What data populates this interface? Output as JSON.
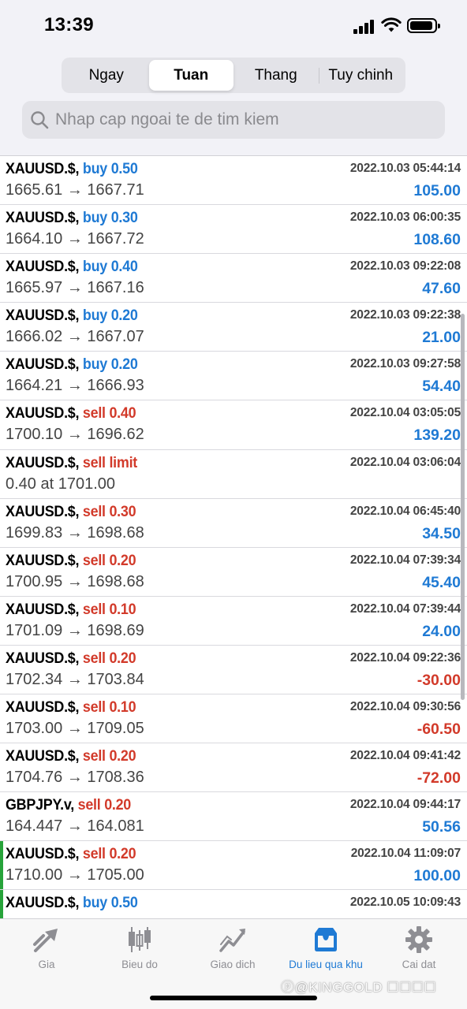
{
  "status_bar": {
    "time": "13:39"
  },
  "segments": {
    "items": [
      "Ngay",
      "Tuan",
      "Thang",
      "Tuy chinh"
    ],
    "selected": "Tuan"
  },
  "search": {
    "placeholder": "Nhap cap ngoai te de tim kiem"
  },
  "orders": [
    {
      "symbol": "XAUUSD.$,",
      "side": "buy",
      "lots": "0.50",
      "time": "2022.10.03 05:44:14",
      "prices": "1665.61 → 1667.71",
      "profit": "105.00",
      "marked": false
    },
    {
      "symbol": "XAUUSD.$,",
      "side": "buy",
      "lots": "0.30",
      "time": "2022.10.03 06:00:35",
      "prices": "1664.10 → 1667.72",
      "profit": "108.60",
      "marked": false
    },
    {
      "symbol": "XAUUSD.$,",
      "side": "buy",
      "lots": "0.40",
      "time": "2022.10.03 09:22:08",
      "prices": "1665.97 → 1667.16",
      "profit": "47.60",
      "marked": false
    },
    {
      "symbol": "XAUUSD.$,",
      "side": "buy",
      "lots": "0.20",
      "time": "2022.10.03 09:22:38",
      "prices": "1666.02 → 1667.07",
      "profit": "21.00",
      "marked": false
    },
    {
      "symbol": "XAUUSD.$,",
      "side": "buy",
      "lots": "0.20",
      "time": "2022.10.03 09:27:58",
      "prices": "1664.21 → 1666.93",
      "profit": "54.40",
      "marked": false
    },
    {
      "symbol": "XAUUSD.$,",
      "side": "sell",
      "lots": "0.40",
      "time": "2022.10.04 03:05:05",
      "prices": "1700.10 → 1696.62",
      "profit": "139.20",
      "marked": false
    },
    {
      "symbol": "XAUUSD.$,",
      "side": "sell",
      "lots": "limit",
      "time": "2022.10.04 03:06:04",
      "prices": "0.40 at 1701.00",
      "profit": "",
      "marked": false
    },
    {
      "symbol": "XAUUSD.$,",
      "side": "sell",
      "lots": "0.30",
      "time": "2022.10.04 06:45:40",
      "prices": "1699.83 → 1698.68",
      "profit": "34.50",
      "marked": false
    },
    {
      "symbol": "XAUUSD.$,",
      "side": "sell",
      "lots": "0.20",
      "time": "2022.10.04 07:39:34",
      "prices": "1700.95 → 1698.68",
      "profit": "45.40",
      "marked": false
    },
    {
      "symbol": "XAUUSD.$,",
      "side": "sell",
      "lots": "0.10",
      "time": "2022.10.04 07:39:44",
      "prices": "1701.09 → 1698.69",
      "profit": "24.00",
      "marked": false
    },
    {
      "symbol": "XAUUSD.$,",
      "side": "sell",
      "lots": "0.20",
      "time": "2022.10.04 09:22:36",
      "prices": "1702.34 → 1703.84",
      "profit": "-30.00",
      "marked": false
    },
    {
      "symbol": "XAUUSD.$,",
      "side": "sell",
      "lots": "0.10",
      "time": "2022.10.04 09:30:56",
      "prices": "1703.00 → 1709.05",
      "profit": "-60.50",
      "marked": false
    },
    {
      "symbol": "XAUUSD.$,",
      "side": "sell",
      "lots": "0.20",
      "time": "2022.10.04 09:41:42",
      "prices": "1704.76 → 1708.36",
      "profit": "-72.00",
      "marked": false
    },
    {
      "symbol": "GBPJPY.v,",
      "side": "sell",
      "lots": "0.20",
      "time": "2022.10.04 09:44:17",
      "prices": "164.447 → 164.081",
      "profit": "50.56",
      "marked": false
    },
    {
      "symbol": "XAUUSD.$,",
      "side": "sell",
      "lots": "0.20",
      "time": "2022.10.04 11:09:07",
      "prices": "1710.00 → 1705.00",
      "profit": "100.00",
      "marked": true
    },
    {
      "symbol": "XAUUSD.$,",
      "side": "buy",
      "lots": "0.50",
      "time": "2022.10.05 10:09:43",
      "prices": "",
      "profit": "",
      "marked": true
    }
  ],
  "tabbar": {
    "items": [
      {
        "label": "Gia",
        "icon": "quotes-arrows-icon",
        "active": false
      },
      {
        "label": "Bieu do",
        "icon": "candlestick-chart-icon",
        "active": false
      },
      {
        "label": "Giao dich",
        "icon": "trade-chart-icon",
        "active": false
      },
      {
        "label": "Du lieu qua khu",
        "icon": "history-inbox-icon",
        "active": true
      },
      {
        "label": "Cai dat",
        "icon": "gear-icon",
        "active": false
      }
    ]
  },
  "watermark": "ⓟ@KINGGOLD ☐☐☐☐",
  "colors": {
    "buy": "#1f7ad4",
    "sell": "#d23a2a",
    "active_tab": "#1f7ad4",
    "marker": "#27a33a"
  }
}
